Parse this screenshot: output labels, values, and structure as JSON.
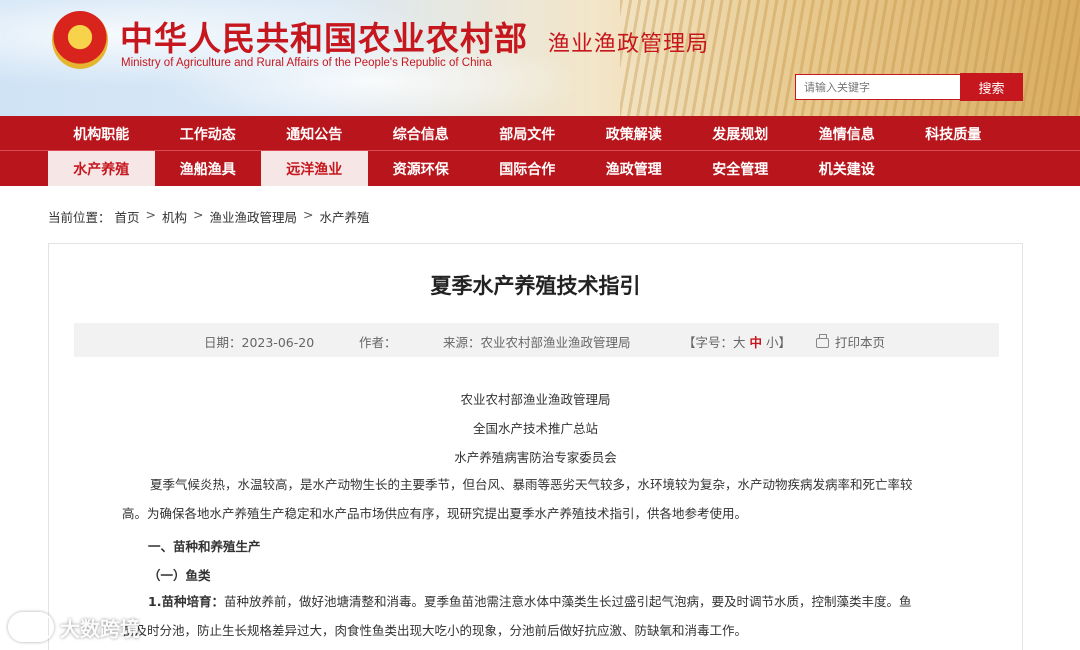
{
  "header": {
    "site_title": "中华人民共和国农业农村部",
    "site_subtitle": "Ministry of Agriculture and Rural Affairs of the People's Republic of China",
    "bureau_name": "渔业渔政管理局",
    "search_placeholder": "请输入关键字",
    "search_button": "搜索"
  },
  "nav": {
    "row1": [
      "机构职能",
      "工作动态",
      "通知公告",
      "综合信息",
      "部局文件",
      "政策解读",
      "发展规划",
      "渔情信息",
      "科技质量"
    ],
    "row2": [
      "水产养殖",
      "渔船渔具",
      "远洋渔业",
      "资源环保",
      "国际合作",
      "渔政管理",
      "安全管理",
      "机关建设"
    ],
    "active_row2": [
      "水产养殖",
      "远洋渔业"
    ]
  },
  "breadcrumb": {
    "prefix": "当前位置：",
    "items": [
      "首页",
      "机构",
      "渔业渔政管理局",
      "水产养殖"
    ],
    "separator": ">"
  },
  "article": {
    "title": "夏季水产养殖技术指引",
    "meta": {
      "date": "日期：2023-06-20",
      "author": "作者：",
      "source": "来源：农业农村部渔业渔政管理局",
      "font_size_prefix": "【字号：",
      "font_large": "大",
      "font_medium": "中",
      "font_small": "小",
      "font_size_suffix": "】",
      "print": "打印本页"
    },
    "orgs": [
      "农业农村部渔业渔政管理局",
      "全国水产技术推广总站",
      "水产养殖病害防治专家委员会"
    ],
    "para1_line1": "夏季气候炎热，水温较高，是水产动物生长的主要季节，但台风、暴雨等恶劣天气较多，水环境较为复杂，水产动物疾病发病率和死亡率较",
    "para1_line2": "高。为确保各地水产养殖生产稳定和水产品市场供应有序，现研究提出夏季水产养殖技术指引，供各地参考使用。",
    "heading1": "一、苗种和养殖生产",
    "heading2": "（一）鱼类",
    "para2_label": "1.苗种培育：",
    "para2_line1": "苗种放养前，做好池塘清整和消毒。夏季鱼苗池需注意水体中藻类生长过盛引起气泡病，要及时调节水质，控制藻类丰度。鱼",
    "para2_line2": "苗及时分池，防止生长规格差异过大，肉食性鱼类出现大吃小的现象，分池前后做好抗应激、防缺氧和消毒工作。"
  },
  "watermark": {
    "text": "大数跨境"
  },
  "colors": {
    "brand_red": "#c6171e",
    "nav_bg": "#b8151c",
    "active_tab_bg": "#f7e6e6"
  }
}
